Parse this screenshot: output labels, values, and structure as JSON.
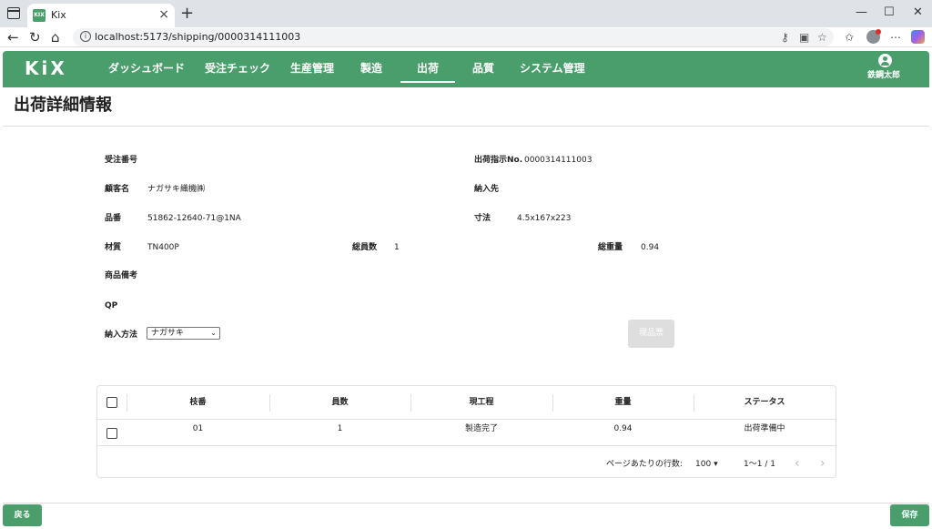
{
  "browser": {
    "tab_title": "Kix",
    "favicon_text": "KIX",
    "url": "localhost:5173/shipping/0000314111003",
    "icons": [
      "sidebar-toggle-icon",
      "close-icon",
      "new-tab-icon",
      "minimize-icon",
      "maximize-icon",
      "window-close-icon",
      "back-icon",
      "reload-icon",
      "home-icon",
      "site-info-icon",
      "key-icon",
      "reader-icon",
      "star-icon",
      "favorites-icon",
      "profile-icon",
      "more-icon",
      "copilot-icon"
    ]
  },
  "app": {
    "logo": "KiX",
    "nav": [
      "ダッシュボード",
      "受注チェック",
      "生産管理",
      "製造",
      "出荷",
      "品質",
      "システム管理"
    ],
    "active_nav": "出荷",
    "user_name": "鉄鋼太郎"
  },
  "page": {
    "title": "出荷詳細情報"
  },
  "form": {
    "order_number_label": "受注番号",
    "order_number_value": "",
    "shipping_instruction_label": "出荷指示No.",
    "shipping_instruction_value": "0000314111003",
    "customer_label": "顧客名",
    "customer_value": "ナガサキ織機㈱",
    "delivery_dest_label": "納入先",
    "delivery_dest_value": "",
    "part_no_label": "品番",
    "part_no_value": "51862-12640-71@1NA",
    "dimension_label": "寸法",
    "dimension_value": "4.5x167x223",
    "material_label": "材質",
    "material_value": "TN400P",
    "total_count_label": "総員数",
    "total_count_value": "1",
    "total_weight_label": "総重量",
    "total_weight_value": "0.94",
    "product_note_label": "商品備考",
    "qp_label": "QP",
    "delivery_method_label": "納入方法",
    "delivery_method_value": "ナガサキ",
    "print_button": "現品票"
  },
  "table": {
    "headers": [
      "枝番",
      "員数",
      "現工程",
      "重量",
      "ステータス"
    ],
    "rows": [
      [
        "01",
        "1",
        "製造完了",
        "0.94",
        "出荷準備中"
      ]
    ],
    "rows_per_page_label": "ページあたりの行数:",
    "rows_per_page_value": "100",
    "range": "1〜1 / 1"
  },
  "footer": {
    "back_button": "戻る",
    "save_button": "保存"
  },
  "colors": {
    "brand_green": "#4a9e6b"
  }
}
